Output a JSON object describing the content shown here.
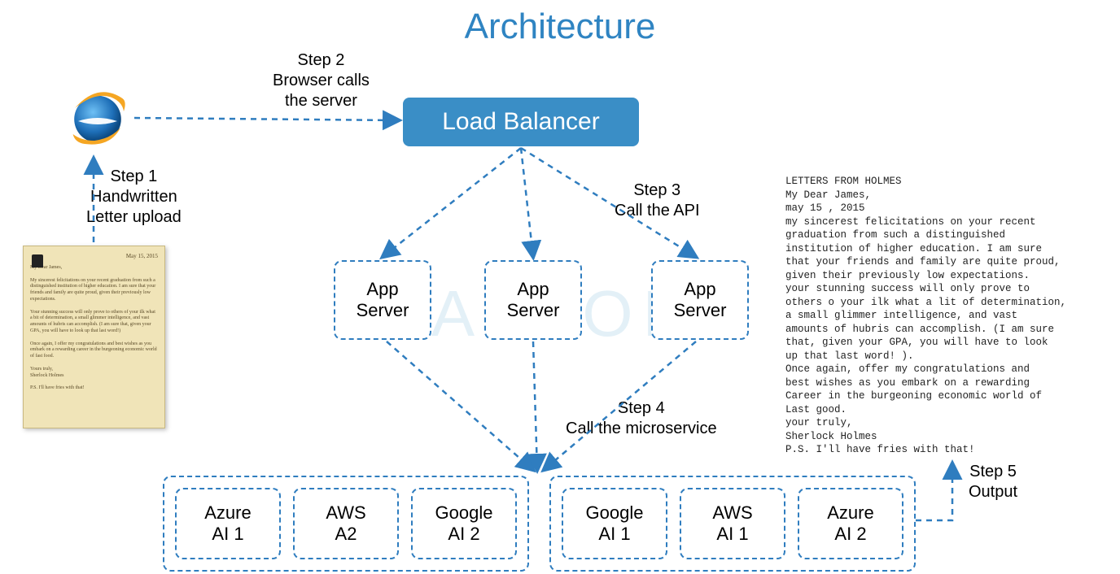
{
  "title": "Architecture",
  "watermark": "CAZTON",
  "steps": {
    "s1": {
      "line1": "Step 1",
      "line2": "Handwritten",
      "line3": "Letter upload"
    },
    "s2": {
      "line1": "Step 2",
      "line2": "Browser calls",
      "line3": "the server"
    },
    "s3": {
      "line1": "Step 3",
      "line2": "Call the API"
    },
    "s4": {
      "line1": "Step 4",
      "line2": "Call the microservice"
    },
    "s5": {
      "line1": "Step 5",
      "line2": "Output"
    }
  },
  "load_balancer": "Load Balancer",
  "app_servers": [
    "App\nServer",
    "App\nServer",
    "App\nServer"
  ],
  "ms_group1": [
    "Azure\nAI 1",
    "AWS\nA2",
    "Google\nAI 2"
  ],
  "ms_group2": [
    "Google\nAI 1",
    "AWS\nAI 1",
    "Azure\nAI 2"
  ],
  "output_letter": "LETTERS FROM HOLMES\nMy Dear James,\nmay 15 , 2015\nmy sincerest felicitations on your recent\ngraduation from such a distinguished\ninstitution of higher education. I am sure\nthat your friends and family are quite proud,\ngiven their previously low expectations.\nyour stunning success will only prove to\nothers o your ilk what a lit of determination,\na small glimmer intelligence, and vast\namounts of hubris can accomplish. (I am sure\nthat, given your GPA, you will have to look\nup that last word! ).\nOnce again, offer my congratulations and\nbest wishes as you embark on a rewarding\nCareer in the burgeoning economic world of\nLast good.\nyour truly,\nSherlock Holmes\nP.S. I'll have fries with that!",
  "handwritten_sample": "My Dear James,\n\nMy sincerest felicitations on your recent graduation from such a distinguished institution of higher education. I am sure that your friends and family are quite proud, given their previously low expectations.\n\nYour stunning success will only prove to others of your ilk what a bit of determination, a small glimmer intelligence, and vast amounts of hubris can accomplish. (I am sure that, given your GPA, you will have to look up that last word!)\n\nOnce again, I offer my congratulations and best wishes as you embark on a rewarding career in the burgeoning economic world of fast food.\n\nYours truly,\nSherlock Holmes\n\nP.S. I'll have fries with that!"
}
